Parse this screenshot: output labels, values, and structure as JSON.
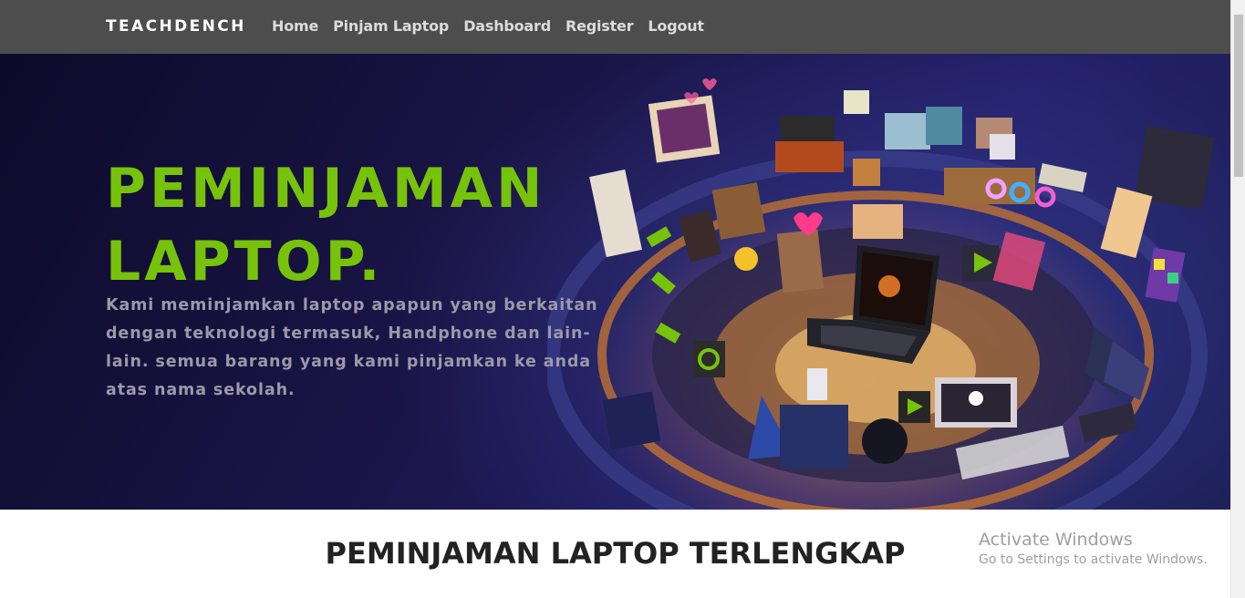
{
  "navbar": {
    "brand": "TEACHDENCH",
    "links": [
      "Home",
      "Pinjam Laptop",
      "Dashboard",
      "Register",
      "Logout"
    ]
  },
  "hero": {
    "title_line1": "PEMINJAMAN",
    "title_line2": "LAPTOP.",
    "description": "Kami meminjamkan laptop apapun yang berkaitan dengan teknologi termasuk, Handphone dan lain-lain. semua barang yang kami pinjamkan ke anda atas nama sekolah.",
    "accent_color": "#77c20a"
  },
  "section": {
    "title": "PEMINJAMAN LAPTOP TERLENGKAP"
  },
  "watermark": {
    "title": "Activate Windows",
    "subtitle": "Go to Settings to activate Windows."
  }
}
